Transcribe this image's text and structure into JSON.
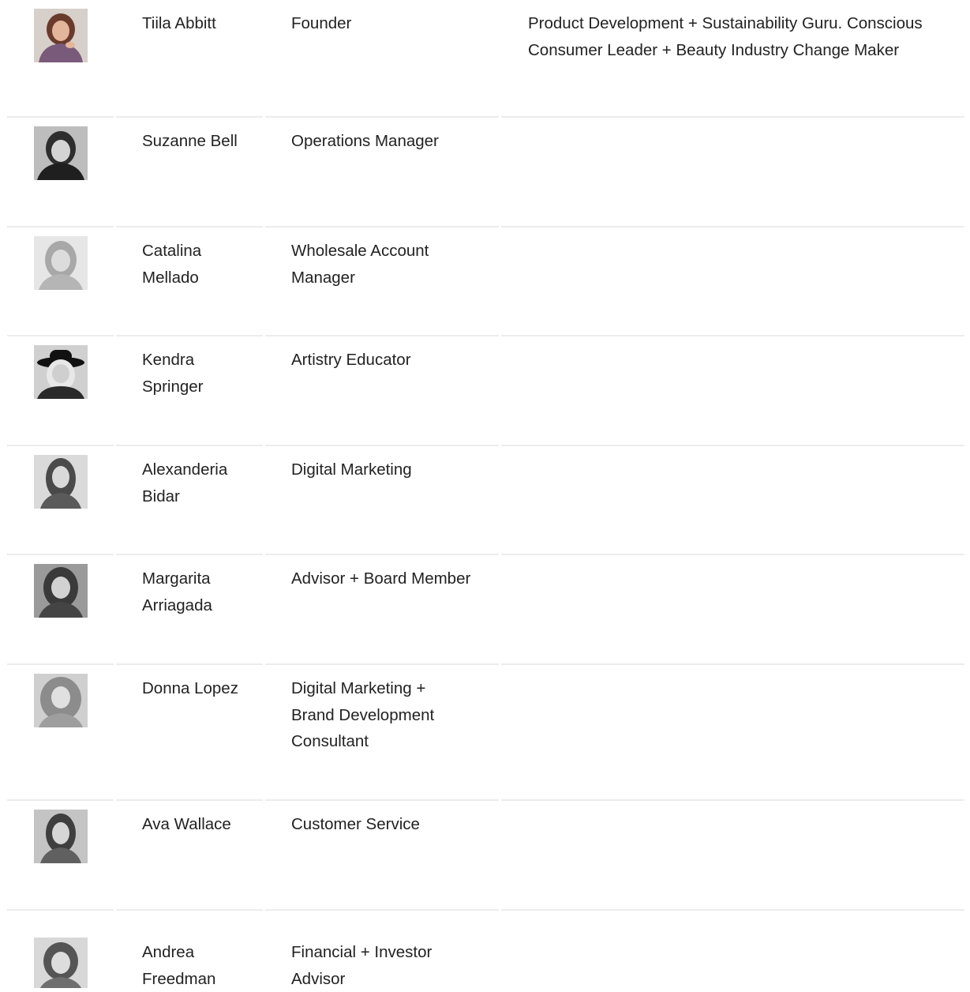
{
  "team": {
    "members": [
      {
        "name": "Tiila Abbitt",
        "role": "Founder",
        "bio": "Product Development + Sustainability Guru. Conscious Consumer Leader + Beauty Industry Change Maker",
        "photo": "avatar-color"
      },
      {
        "name": "Suzanne Bell",
        "role": "Operations Manager",
        "bio": "",
        "photo": "avatar-grayscale"
      },
      {
        "name": "Catalina Mellado",
        "role": "Wholesale Account Manager",
        "bio": "",
        "photo": "avatar-grayscale"
      },
      {
        "name": "Kendra Springer",
        "role": "Artistry Educator",
        "bio": "",
        "photo": "avatar-grayscale-hat"
      },
      {
        "name": "Alexanderia Bidar",
        "role": "Digital Marketing",
        "bio": "",
        "photo": "avatar-grayscale"
      },
      {
        "name": "Margarita Arriagada",
        "role": "Advisor + Board Member",
        "bio": "",
        "photo": "avatar-grayscale"
      },
      {
        "name": "Donna Lopez",
        "role": "Digital Marketing + Brand Development Consultant",
        "bio": "",
        "photo": "avatar-grayscale"
      },
      {
        "name": "Ava Wallace",
        "role": "Customer Service",
        "bio": "",
        "photo": "avatar-grayscale"
      },
      {
        "name": "Andrea Freedman",
        "role": "Financial + Investor Advisor",
        "bio": "",
        "photo": "avatar-grayscale"
      }
    ]
  },
  "colors": {
    "text": "#222222",
    "divider": "#ececec",
    "background": "#ffffff"
  }
}
